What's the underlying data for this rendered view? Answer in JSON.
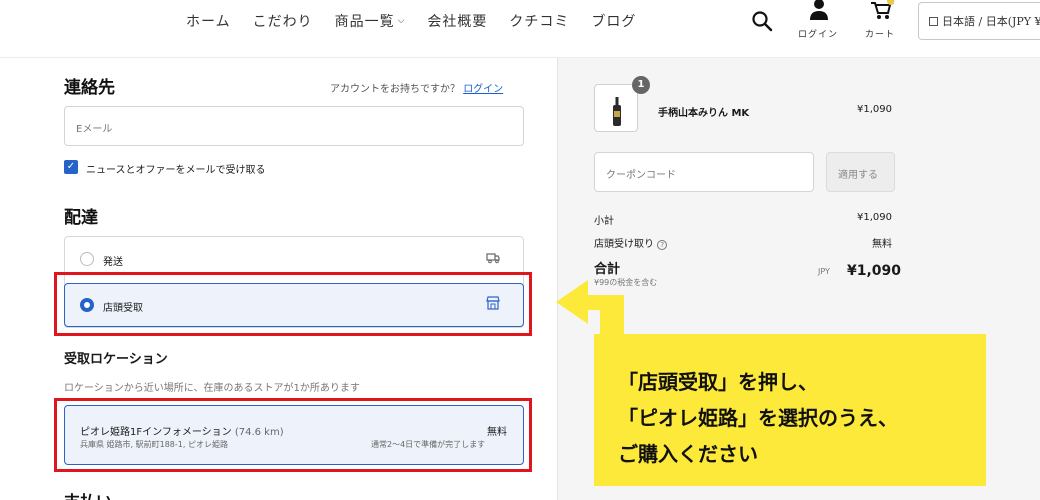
{
  "header": {
    "nav": [
      "ホーム",
      "こだわり",
      "商品一覧",
      "会社概要",
      "クチコミ",
      "ブログ"
    ],
    "login_label": "ログイン",
    "cart_label": "カート",
    "language": "日本語 / 日本(JPY ¥)"
  },
  "contact": {
    "title": "連絡先",
    "account_prompt": "アカウントをお持ちですか？",
    "login_link": "ログイン",
    "email_placeholder": "Eメール",
    "newsletter_label": "ニュースとオファーをメールで受け取る",
    "newsletter_checked": true
  },
  "delivery": {
    "title": "配達",
    "options": [
      {
        "label": "発送",
        "selected": false,
        "icon": "truck-icon"
      },
      {
        "label": "店頭受取",
        "selected": true,
        "icon": "store-icon"
      }
    ]
  },
  "pickup": {
    "title": "受取ロケーション",
    "note": "ロケーションから近い場所に、在庫のあるストアが1か所あります",
    "location_name": "ピオレ姫路1Fインフォメーション",
    "distance": "(74.6 km)",
    "price": "無料",
    "address": "兵庫県 姫路市, 駅前町188-1, ピオレ姫路",
    "ready_time": "通常2〜4日で準備が完了します"
  },
  "payment": {
    "title": "支払い"
  },
  "summary": {
    "item_qty": "1",
    "item_name": "手柄山本みりん MK",
    "item_price": "¥1,090",
    "coupon_placeholder": "クーポンコード",
    "apply_label": "適用する",
    "subtotal_label": "小計",
    "subtotal_value": "¥1,090",
    "pickup_label": "店頭受け取り",
    "pickup_value": "無料",
    "total_label": "合計",
    "tax_note": "¥99の税金を含む",
    "currency": "JPY",
    "total_value": "¥1,090"
  },
  "callout": {
    "line1": "「店頭受取」を押し、",
    "line2": "「ピオレ姫路」を選択のうえ、",
    "line3": "ご購入ください"
  },
  "colors": {
    "accent": "#2563c9",
    "highlight_frame": "#e0161e",
    "callout_bg": "#fde93a",
    "arrow": "#fde93a"
  }
}
